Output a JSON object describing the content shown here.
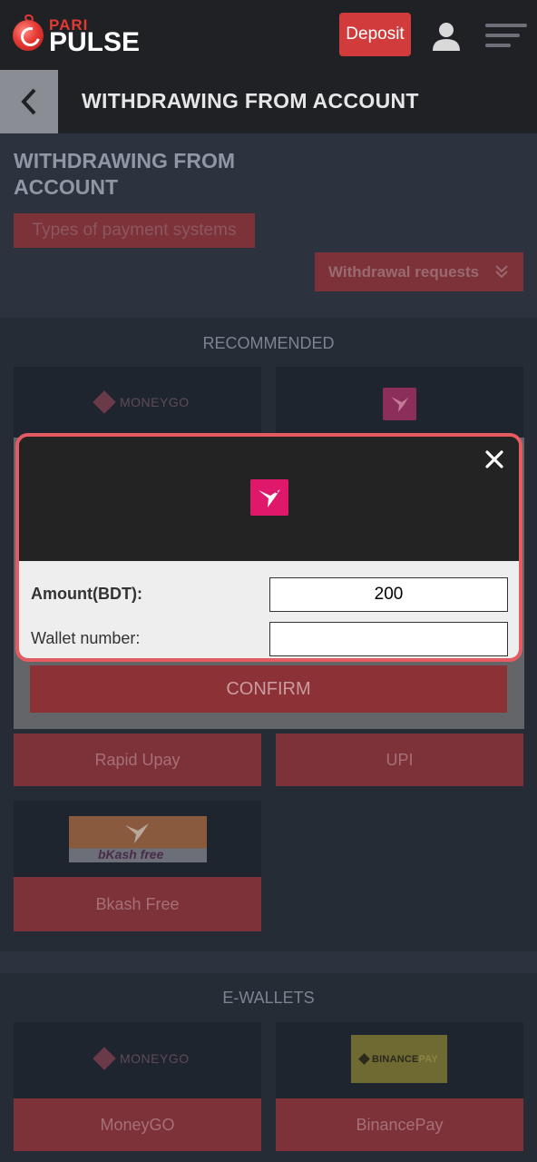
{
  "header": {
    "logo_top": "PARI",
    "logo_bottom": "PULSE",
    "deposit_label": "Deposit"
  },
  "titlebar": {
    "title": "WITHDRAWING FROM ACCOUNT"
  },
  "page": {
    "heading": "WITHDRAWING FROM ACCOUNT",
    "types_button": "Types of payment systems",
    "requests_button": "Withdrawal requests"
  },
  "recommended": {
    "title": "RECOMMENDED",
    "moneygo_logo": "MONEYGO",
    "rapid_upay": "Rapid Upay",
    "upi": "UPI",
    "bkash_logo": "bKash free",
    "bkash_free": "Bkash Free"
  },
  "ewallets": {
    "title": "E-WALLETS",
    "moneygo_logo": "MONEYGO",
    "moneygo": "MoneyGO",
    "binance_logo_main": "BINANCE",
    "binance_logo_pay": "PAY",
    "binancepay": "BinancePay"
  },
  "modal": {
    "amount_label": "Amount(BDT):",
    "amount_value": "200",
    "wallet_label": "Wallet number:",
    "wallet_value": "",
    "confirm_label": "CONFIRM"
  },
  "colors": {
    "accent": "#d23b3b",
    "modal_border": "#e65a62",
    "dark_bg": "#1f2125"
  }
}
